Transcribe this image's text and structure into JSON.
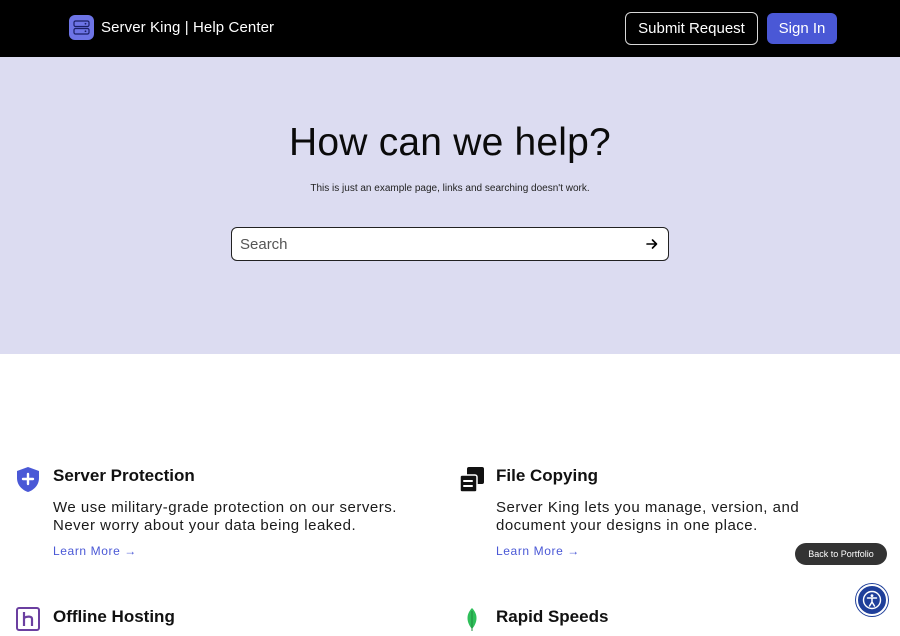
{
  "header": {
    "brand_text": "Server King | Help Center",
    "submit_label": "Submit Request",
    "signin_label": "Sign In"
  },
  "hero": {
    "title": "How can we help?",
    "note": "This is just an example page, links and searching doesn't work.",
    "search_placeholder": "Search"
  },
  "features": [
    {
      "icon": "shield-plus-icon",
      "title": "Server Protection",
      "description": "We use military-grade protection on our servers. Never worry about your data being leaked.",
      "link": "Learn More →"
    },
    {
      "icon": "copy-files-icon",
      "title": "File Copying",
      "description": "Server King lets you manage, version, and document your designs in one place.",
      "link": "Learn More →"
    },
    {
      "icon": "heroku-icon",
      "title": "Offline Hosting"
    },
    {
      "icon": "leaf-icon",
      "title": "Rapid Speeds"
    }
  ],
  "back_portfolio_label": "Back to Portfolio",
  "colors": {
    "header_bg": "#000000",
    "hero_bg": "#dcdcf1",
    "accent": "#4a58d6",
    "shield": "#4a58d6",
    "leaf": "#2fbf5a",
    "heroku": "#6b3fa0"
  }
}
